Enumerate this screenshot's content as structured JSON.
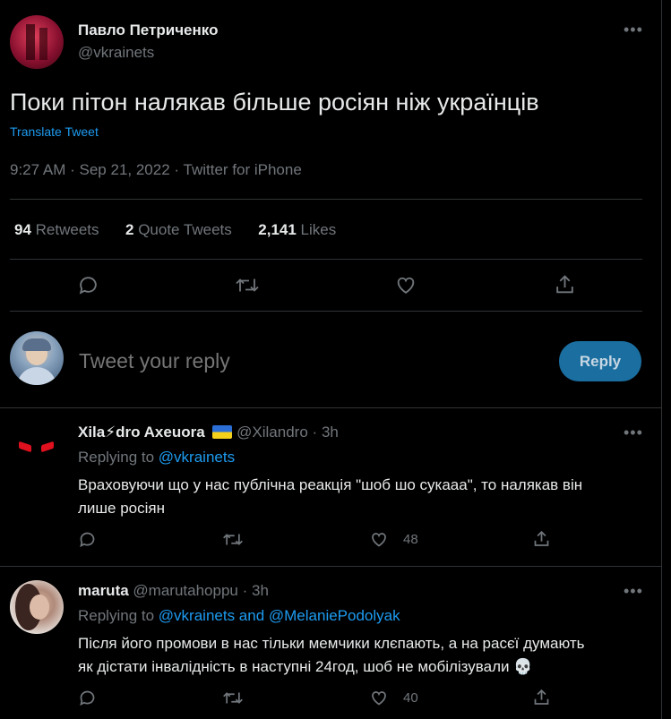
{
  "tweet": {
    "author_name": "Павло Петриченко",
    "author_handle": "@vkrainets",
    "text": "Поки пітон налякав більше росіян ніж українців",
    "translate": "Translate Tweet",
    "time": "9:27 AM",
    "date": "Sep 21, 2022",
    "source": "Twitter for iPhone",
    "sep": "·",
    "stats": {
      "retweets_count": "94",
      "retweets_label": "Retweets",
      "quotes_count": "2",
      "quotes_label": "Quote Tweets",
      "likes_count": "2,141",
      "likes_label": "Likes"
    }
  },
  "compose": {
    "placeholder": "Tweet your reply",
    "button": "Reply"
  },
  "replies": [
    {
      "name": "Xila⚡dro Axeuora",
      "flag": "UA",
      "handle": "@Xilandro",
      "time": "3h",
      "replying_label": "Replying to",
      "replying_to": "@vkrainets",
      "text_line1": "Враховуючи що у нас публічна реакція \"шоб шо сукааа\", то налякав він",
      "text_line2": "лише росіян",
      "likes": "48"
    },
    {
      "name": "maruta",
      "handle": "@marutahoppu",
      "time": "3h",
      "replying_label": "Replying to",
      "replying_to": "@vkrainets and @MelaniePodolyak",
      "text_line1": "Після його промови в нас тільки мемчики клєпають, а на расєї думають",
      "text_line2": "як дістати інвалідність в наступні 24год, шоб не мобілізували 💀",
      "likes": "40"
    }
  ],
  "colors": {
    "accent": "#1d9bf0",
    "muted": "#71767b",
    "divider": "#2f3336",
    "background": "#000000"
  }
}
